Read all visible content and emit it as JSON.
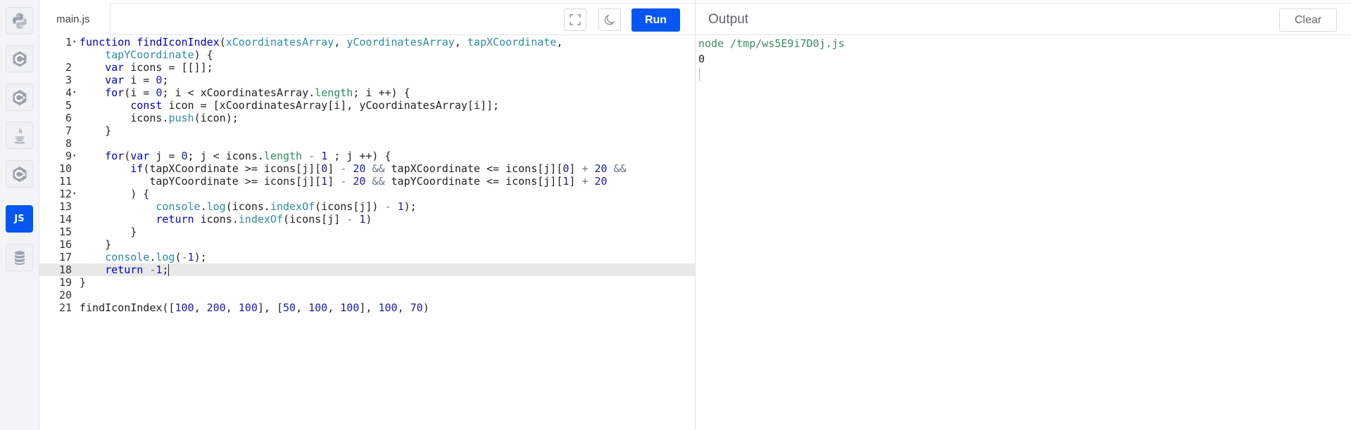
{
  "sidebar": {
    "languages": [
      {
        "name": "Python",
        "icon": "python-icon"
      },
      {
        "name": "C",
        "icon": "c-icon"
      },
      {
        "name": "C++",
        "icon": "cpp-icon"
      },
      {
        "name": "Java",
        "icon": "java-icon"
      },
      {
        "name": "C#",
        "icon": "csharp-icon"
      },
      {
        "name": "JavaScript",
        "icon": "js-icon",
        "label": "JS",
        "active": true
      },
      {
        "name": "SQL",
        "icon": "database-icon"
      }
    ],
    "active_color": "#0556f3"
  },
  "editor": {
    "file_name": "main.js",
    "run_label": "Run",
    "fullscreen_icon": "fullscreen-icon",
    "theme_icon": "moon-icon",
    "active_line": 18,
    "lines": [
      {
        "n": "1",
        "fold": true,
        "code": "function findIconIndex(xCoordinatesArray, yCoordinatesArray, tapXCoordinate,"
      },
      {
        "n": "",
        "fold": false,
        "code": "    tapYCoordinate) {"
      },
      {
        "n": "2",
        "fold": false,
        "code": "    var icons = [[]];"
      },
      {
        "n": "3",
        "fold": false,
        "code": "    var i = 0;"
      },
      {
        "n": "4",
        "fold": true,
        "code": "    for(i = 0; i < xCoordinatesArray.length; i ++) {"
      },
      {
        "n": "5",
        "fold": false,
        "code": "        const icon = [xCoordinatesArray[i], yCoordinatesArray[i]];"
      },
      {
        "n": "6",
        "fold": false,
        "code": "        icons.push(icon);"
      },
      {
        "n": "7",
        "fold": false,
        "code": "    }"
      },
      {
        "n": "8",
        "fold": false,
        "code": ""
      },
      {
        "n": "9",
        "fold": true,
        "code": "    for(var j = 0; j < icons.length - 1 ; j ++) {"
      },
      {
        "n": "10",
        "fold": false,
        "code": "        if(tapXCoordinate >= icons[j][0] - 20 && tapXCoordinate <= icons[j][0] + 20 &&"
      },
      {
        "n": "11",
        "fold": false,
        "code": "           tapYCoordinate >= icons[j][1] - 20 && tapYCoordinate <= icons[j][1] + 20"
      },
      {
        "n": "12",
        "fold": true,
        "code": "        ) {"
      },
      {
        "n": "13",
        "fold": false,
        "code": "            console.log(icons.indexOf(icons[j]) - 1);"
      },
      {
        "n": "14",
        "fold": false,
        "code": "            return icons.indexOf(icons[j] - 1)"
      },
      {
        "n": "15",
        "fold": false,
        "code": "        }"
      },
      {
        "n": "16",
        "fold": false,
        "code": "    }"
      },
      {
        "n": "17",
        "fold": false,
        "code": "    console.log(-1);"
      },
      {
        "n": "18",
        "fold": false,
        "code": "    return -1;"
      },
      {
        "n": "19",
        "fold": false,
        "code": "}"
      },
      {
        "n": "20",
        "fold": false,
        "code": ""
      },
      {
        "n": "21",
        "fold": false,
        "code": "findIconIndex([100, 200, 100], [50, 100, 100], 100, 70)"
      }
    ]
  },
  "output": {
    "title": "Output",
    "clear_label": "Clear",
    "command": "node /tmp/ws5E9i7D0j.js",
    "result": "0"
  }
}
